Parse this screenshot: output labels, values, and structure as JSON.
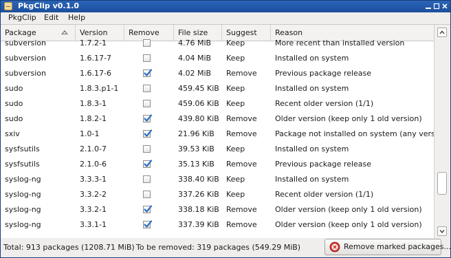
{
  "window": {
    "title": "PkgClip v0.1.0",
    "titlebar_buttons": [
      "minimize-icon",
      "maximize-icon",
      "close-icon"
    ]
  },
  "menu": [
    "PkgClip",
    "Edit",
    "Help"
  ],
  "table": {
    "columns": [
      "Package",
      "Version",
      "Remove",
      "File size",
      "Suggest",
      "Reason"
    ],
    "sort": {
      "column": "Package",
      "direction": "ascending"
    },
    "rows": [
      {
        "package": "subversion",
        "version": "1.7.2-1",
        "remove": false,
        "size": "4.76 MiB",
        "suggest": "Keep",
        "reason": "More recent than installed version"
      },
      {
        "package": "subversion",
        "version": "1.6.17-7",
        "remove": false,
        "size": "4.04 MiB",
        "suggest": "Keep",
        "reason": "Installed on system"
      },
      {
        "package": "subversion",
        "version": "1.6.17-6",
        "remove": true,
        "size": "4.02 MiB",
        "suggest": "Remove",
        "reason": "Previous package release"
      },
      {
        "package": "sudo",
        "version": "1.8.3.p1-1",
        "remove": false,
        "size": "459.45 KiB",
        "suggest": "Keep",
        "reason": "Installed on system"
      },
      {
        "package": "sudo",
        "version": "1.8.3-1",
        "remove": false,
        "size": "459.06 KiB",
        "suggest": "Keep",
        "reason": "Recent older version (1/1)"
      },
      {
        "package": "sudo",
        "version": "1.8.2-1",
        "remove": true,
        "size": "439.80 KiB",
        "suggest": "Remove",
        "reason": "Older version (keep only 1 old version)"
      },
      {
        "package": "sxiv",
        "version": "1.0-1",
        "remove": true,
        "size": "21.96 KiB",
        "suggest": "Remove",
        "reason": "Package not installed on system (any version)"
      },
      {
        "package": "sysfsutils",
        "version": "2.1.0-7",
        "remove": false,
        "size": "39.53 KiB",
        "suggest": "Keep",
        "reason": "Installed on system"
      },
      {
        "package": "sysfsutils",
        "version": "2.1.0-6",
        "remove": true,
        "size": "35.13 KiB",
        "suggest": "Remove",
        "reason": "Previous package release"
      },
      {
        "package": "syslog-ng",
        "version": "3.3.3-1",
        "remove": false,
        "size": "338.40 KiB",
        "suggest": "Keep",
        "reason": "Installed on system"
      },
      {
        "package": "syslog-ng",
        "version": "3.3.2-2",
        "remove": false,
        "size": "337.26 KiB",
        "suggest": "Keep",
        "reason": "Recent older version (1/1)"
      },
      {
        "package": "syslog-ng",
        "version": "3.3.2-1",
        "remove": true,
        "size": "338.18 KiB",
        "suggest": "Remove",
        "reason": "Older version (keep only 1 old version)"
      },
      {
        "package": "syslog-ng",
        "version": "3.3.1-1",
        "remove": true,
        "size": "337.39 KiB",
        "suggest": "Remove",
        "reason": "Older version (keep only 1 old version)"
      }
    ]
  },
  "status": {
    "total": "Total: 913 packages (1208.71 MiB)",
    "to_remove": "To be removed: 319 packages (549.29 MiB)",
    "button_label": "Remove marked packages...",
    "button_icon": "remove-circle-icon"
  },
  "colors": {
    "titlebar": "#1c4f9c",
    "check": "#2a6fc9",
    "remove_icon": "#d2332b"
  }
}
